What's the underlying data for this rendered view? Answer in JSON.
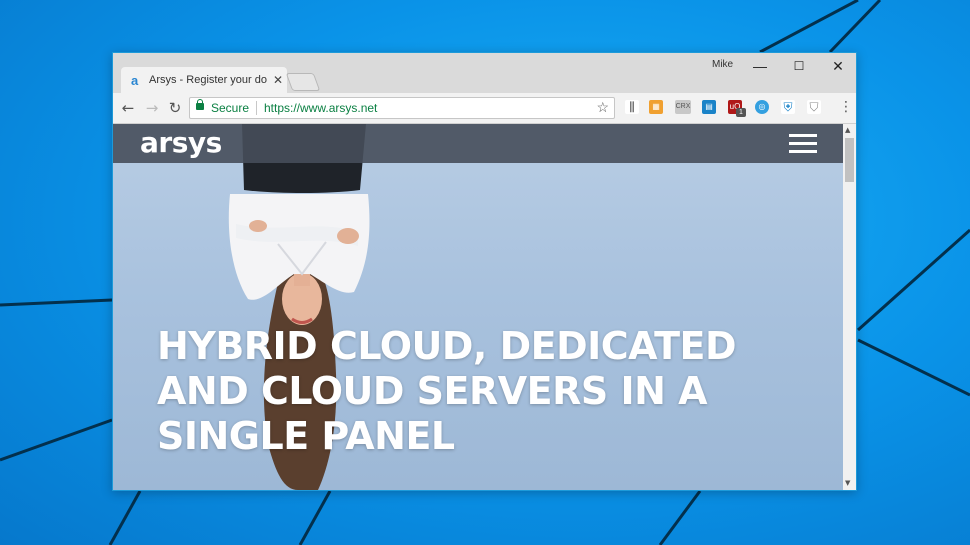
{
  "browser": {
    "tab_title": "Arsys - Register your dom",
    "tab_favicon": "a",
    "user_name": "Mike",
    "window_controls": {
      "minimize": "—",
      "maximize": "☐",
      "close": "✕"
    },
    "security_label": "Secure",
    "url": "https://www.arsys.net",
    "extensions": [
      "equalizer-icon",
      "image-icon",
      "crx-icon",
      "book-icon",
      "ublock-icon",
      "circle-icon",
      "shield-check-icon",
      "shield-icon"
    ],
    "badge_count": "1"
  },
  "site": {
    "logo": "arsys",
    "headline": [
      "HYBRID CLOUD, DEDICATED",
      "AND CLOUD SERVERS IN A",
      "SINGLE PANEL"
    ]
  },
  "colors": {
    "accent_green": "#0b8043",
    "header_bar": "#464e5a",
    "desktop_blue": "#0a93e8"
  }
}
